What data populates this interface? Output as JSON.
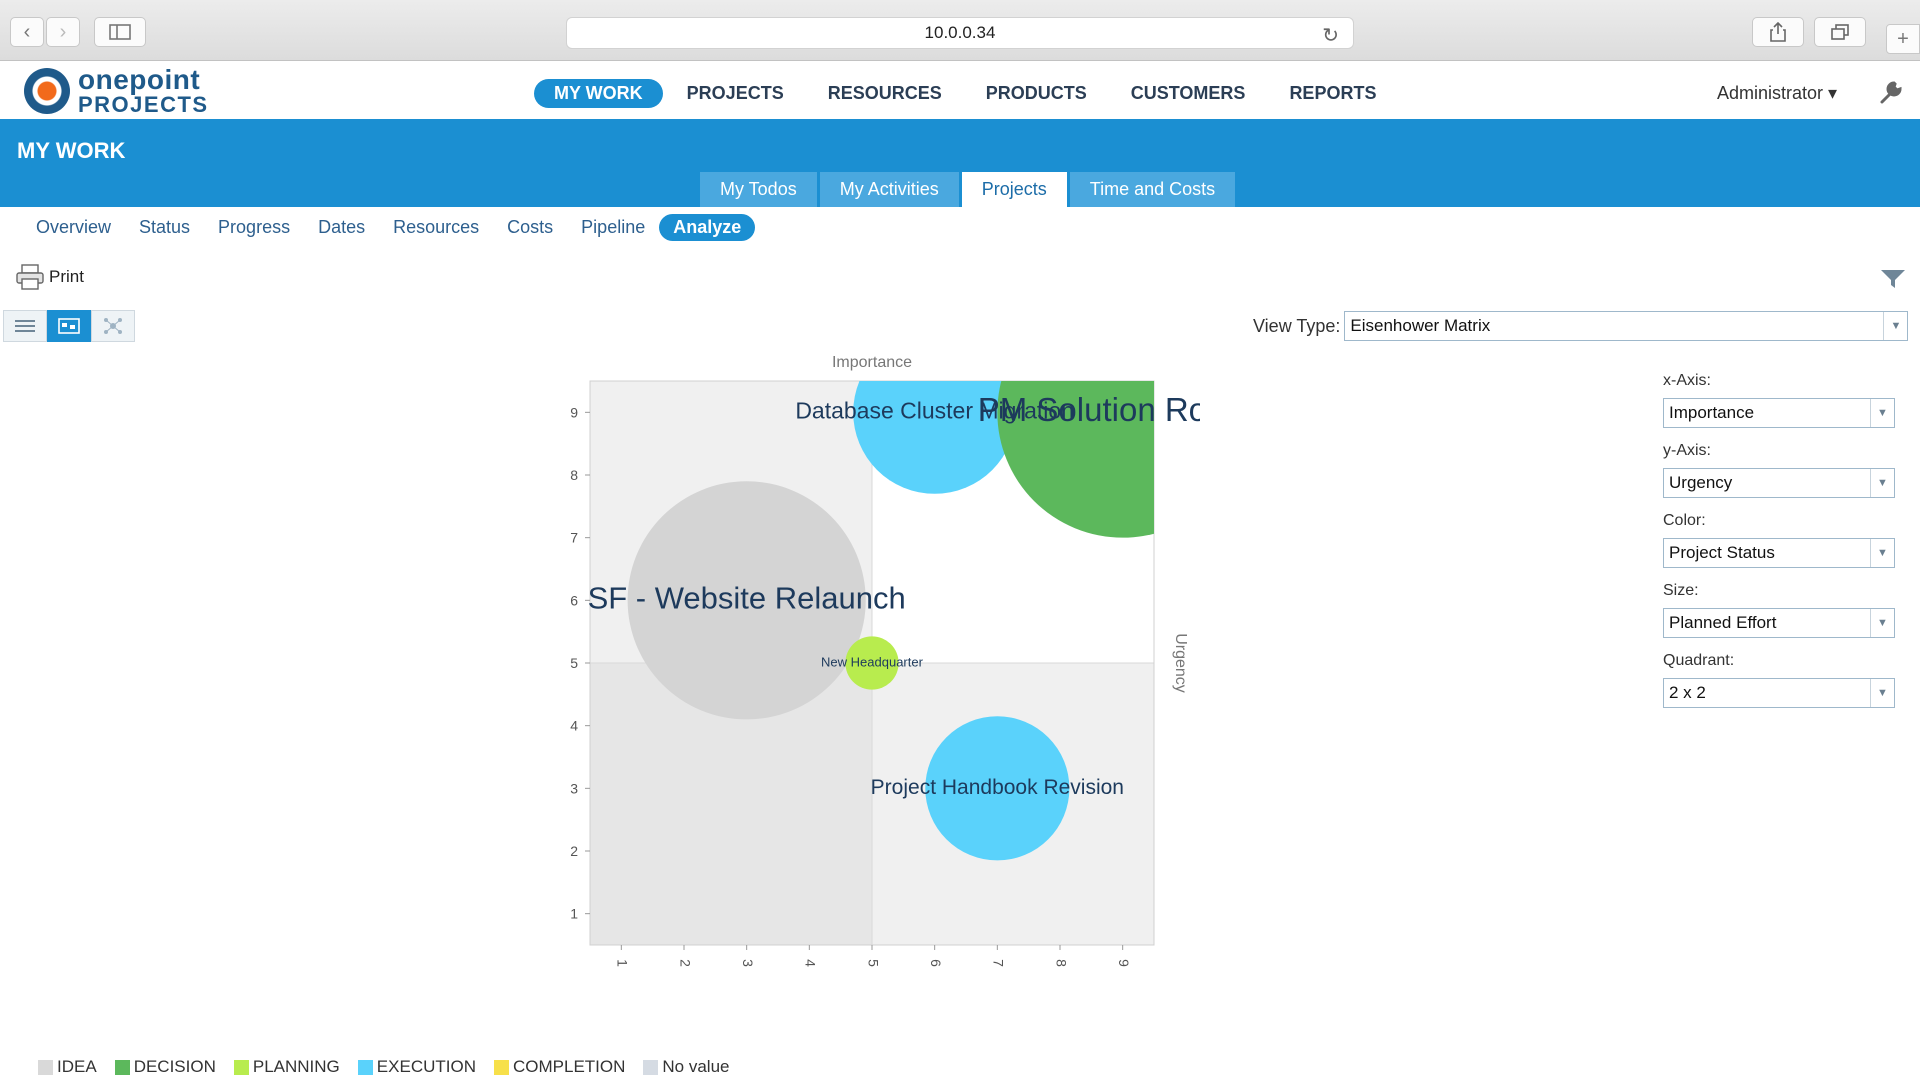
{
  "browser": {
    "url": "10.0.0.34"
  },
  "app": {
    "logo_line1": "onepoint",
    "logo_line2": "PROJECTS",
    "nav": [
      "MY WORK",
      "PROJECTS",
      "RESOURCES",
      "PRODUCTS",
      "CUSTOMERS",
      "REPORTS"
    ],
    "nav_active": 0,
    "user": "Administrator ▾"
  },
  "section": {
    "title": "MY WORK",
    "subtabs": [
      "My Todos",
      "My Activities",
      "Projects",
      "Time and Costs"
    ],
    "subtab_active": 2,
    "analysis_tabs": [
      "Overview",
      "Status",
      "Progress",
      "Dates",
      "Resources",
      "Costs",
      "Pipeline",
      "Analyze"
    ],
    "analysis_active": 7
  },
  "toolbar": {
    "print_label": "Print"
  },
  "view": {
    "label": "View Type:",
    "value": "Eisenhower Matrix"
  },
  "config": {
    "x_label": "x-Axis:",
    "x_value": "Importance",
    "y_label": "y-Axis:",
    "y_value": "Urgency",
    "color_label": "Color:",
    "color_value": "Project Status",
    "size_label": "Size:",
    "size_value": "Planned Effort",
    "quadrant_label": "Quadrant:",
    "quadrant_value": "2 x 2"
  },
  "legend": [
    {
      "label": "IDEA",
      "color": "#d9d9d9"
    },
    {
      "label": "DECISION",
      "color": "#5cb85c"
    },
    {
      "label": "PLANNING",
      "color": "#b8ec4e"
    },
    {
      "label": "EXECUTION",
      "color": "#5ad2fb"
    },
    {
      "label": "COMPLETION",
      "color": "#f7e04a"
    },
    {
      "label": "No value",
      "color": "#d5dbe3"
    }
  ],
  "chart_data": {
    "type": "scatter",
    "subtype": "bubble",
    "xlabel": "Importance",
    "ylabel": "Urgency",
    "xlim": [
      1,
      9
    ],
    "ylim": [
      1,
      9
    ],
    "xticks": [
      "1",
      "2",
      "3",
      "4",
      "5",
      "6",
      "7",
      "8",
      "9"
    ],
    "yticks": [
      "1",
      "2",
      "3",
      "4",
      "5",
      "6",
      "7",
      "8",
      "9"
    ],
    "quadrant_split": [
      5,
      5
    ],
    "points": [
      {
        "name": "SF - Website Relaunch",
        "x": 3,
        "y": 6,
        "size": 3.8,
        "status": "IDEA",
        "color": "#d4d4d4",
        "label_size": 31
      },
      {
        "name": "Database Cluster Migration",
        "x": 6,
        "y": 9,
        "size": 2.6,
        "status": "EXECUTION",
        "color": "#5ad2fb",
        "label_size": 23
      },
      {
        "name": "PM Solution Rollout",
        "x": 9,
        "y": 9,
        "size": 4.0,
        "status": "DECISION",
        "color": "#5cb85c",
        "label_size": 33
      },
      {
        "name": "New Headquarter",
        "x": 5,
        "y": 5,
        "size": 0.85,
        "status": "PLANNING",
        "color": "#b8ec4e",
        "label_size": 13
      },
      {
        "name": "Project Handbook Revision",
        "x": 7,
        "y": 3,
        "size": 2.3,
        "status": "EXECUTION",
        "color": "#5ad2fb",
        "label_size": 21
      }
    ]
  }
}
